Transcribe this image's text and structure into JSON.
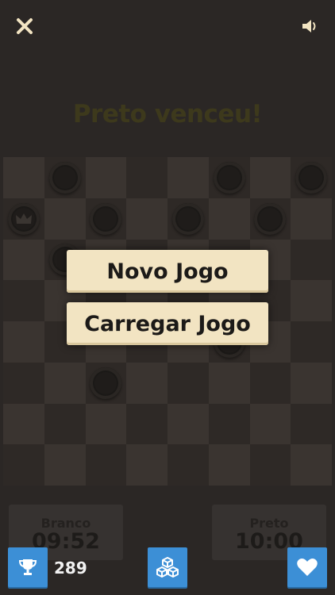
{
  "header": {
    "close_icon": "close-icon",
    "sound_icon": "speaker-icon"
  },
  "status_title": "Preto venceu!",
  "board": {
    "size": 8,
    "pieces": [
      {
        "row": 0,
        "col": 1,
        "color": "black",
        "king": false
      },
      {
        "row": 0,
        "col": 5,
        "color": "black",
        "king": false
      },
      {
        "row": 0,
        "col": 7,
        "color": "black",
        "king": false
      },
      {
        "row": 1,
        "col": 0,
        "color": "black",
        "king": true
      },
      {
        "row": 1,
        "col": 2,
        "color": "black",
        "king": false
      },
      {
        "row": 1,
        "col": 4,
        "color": "black",
        "king": false
      },
      {
        "row": 1,
        "col": 6,
        "color": "black",
        "king": false
      },
      {
        "row": 2,
        "col": 1,
        "color": "black",
        "king": false
      },
      {
        "row": 4,
        "col": 5,
        "color": "black",
        "king": false
      },
      {
        "row": 5,
        "col": 2,
        "color": "black",
        "king": false
      }
    ]
  },
  "menu": {
    "new_game": "Novo Jogo",
    "load_game": "Carregar Jogo"
  },
  "clocks": {
    "white": {
      "name": "Branco",
      "time": "09:52"
    },
    "black": {
      "name": "Preto",
      "time": "10:00"
    }
  },
  "footer": {
    "score": "289",
    "trophy_icon": "trophy-icon",
    "cubes_icon": "cubes-icon",
    "heart_icon": "heart-icon"
  },
  "colors": {
    "accent": "#3c8fd6",
    "button": "#f2e4c2",
    "background": "#2b2725"
  }
}
